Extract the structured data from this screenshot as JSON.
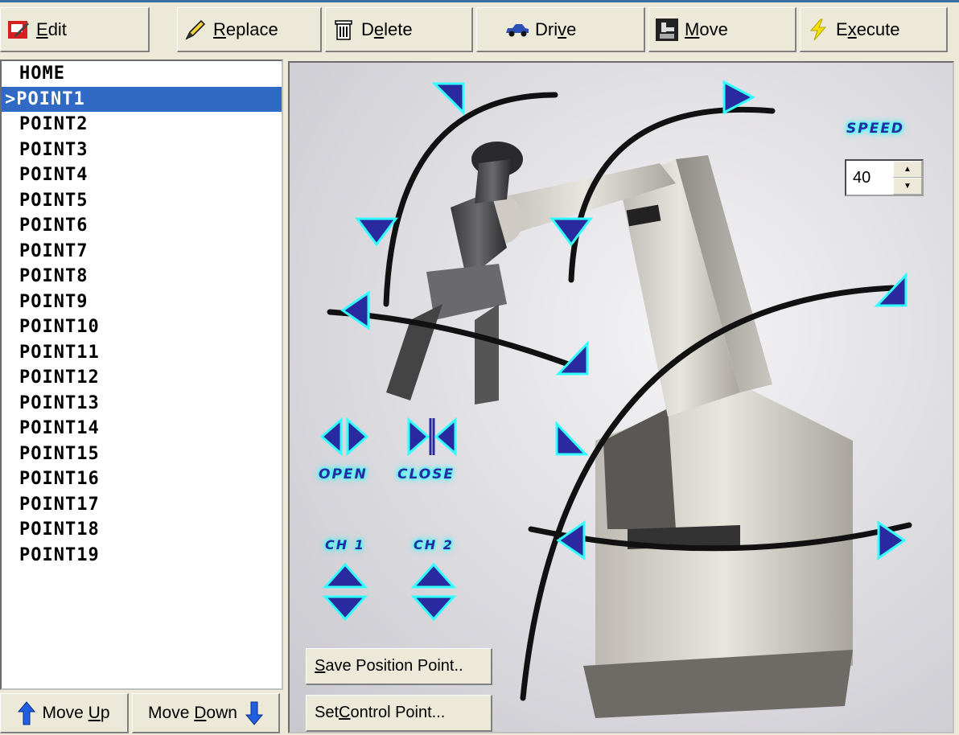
{
  "toolbar": {
    "edit": {
      "pre": "",
      "key": "E",
      "post": "dit",
      "icon": "edit-icon"
    },
    "replace": {
      "pre": "",
      "key": "R",
      "post": "eplace",
      "icon": "pencil-icon"
    },
    "delete": {
      "pre": "D",
      "key": "e",
      "post": "lete",
      "icon": "trash-icon"
    },
    "drive": {
      "pre": "Dri",
      "key": "v",
      "post": "e",
      "icon": "car-icon"
    },
    "move": {
      "pre": "",
      "key": "M",
      "post": "ove",
      "icon": "robot-move-icon"
    },
    "execute": {
      "pre": "E",
      "key": "x",
      "post": "ecute",
      "icon": "lightning-icon"
    }
  },
  "points": {
    "selected_index": 1,
    "items": [
      "HOME",
      ">POINT1",
      "POINT2",
      "POINT3",
      "POINT4",
      "POINT5",
      "POINT6",
      "POINT7",
      "POINT8",
      "POINT9",
      "POINT10",
      "POINT11",
      "POINT12",
      "POINT13",
      "POINT14",
      "POINT15",
      "POINT16",
      "POINT17",
      "POINT18",
      "POINT19"
    ]
  },
  "list_buttons": {
    "move_up": {
      "pre": "Move ",
      "key": "U",
      "post": "p",
      "icon": "arrow-up-icon"
    },
    "move_down": {
      "pre": "Move ",
      "key": "D",
      "post": "own",
      "icon": "arrow-down-icon"
    }
  },
  "robot_panel": {
    "speed_label": "SPEED",
    "speed_value": "40",
    "gripper": {
      "open_label": "OPEN",
      "close_label": "CLOSE"
    },
    "channels": {
      "ch1_label": "CH 1",
      "ch2_label": "CH 2"
    },
    "save_position": {
      "key": "S",
      "post": "ave Position Point.."
    },
    "set_control": {
      "pre": "Set ",
      "key": "C",
      "post": "ontrol Point..."
    },
    "colors": {
      "arrow": "#2a2aa0",
      "glow": "#33ffff",
      "selection": "#316ac5"
    }
  }
}
